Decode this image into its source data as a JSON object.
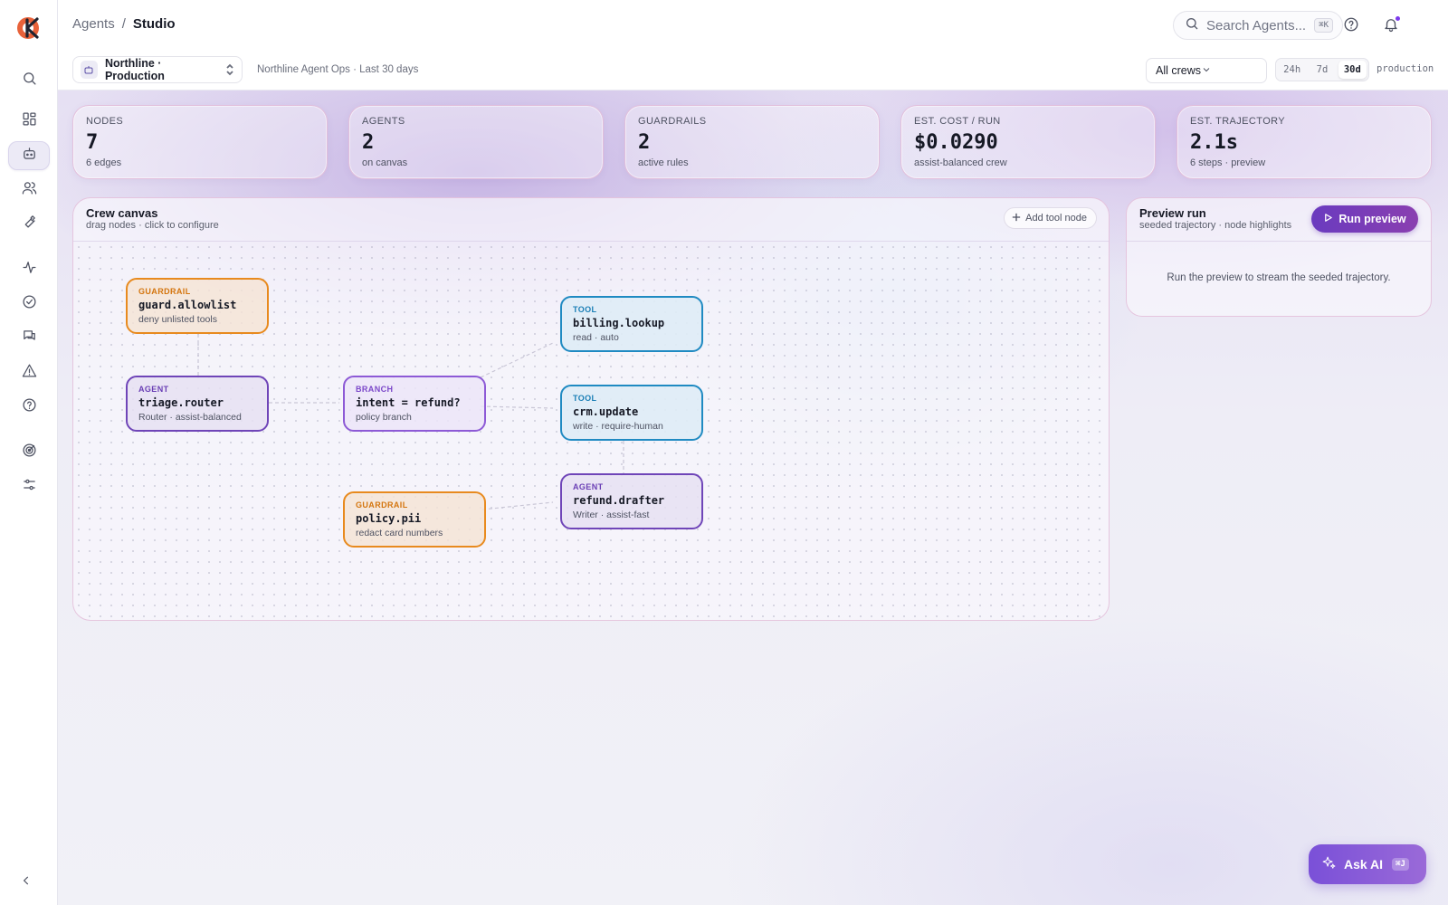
{
  "breadcrumb": {
    "parent": "Agents",
    "separator": "/",
    "current": "Studio"
  },
  "search": {
    "placeholder": "Search Agents...",
    "shortcut": "⌘K"
  },
  "workspace": {
    "name": "Northline · Production",
    "context": "Northline Agent Ops · Last 30 days"
  },
  "filters": {
    "crew": "All crews",
    "ranges": [
      "24h",
      "7d",
      "30d"
    ],
    "active_range": "30d",
    "environment": "production"
  },
  "stats": [
    {
      "label": "NODES",
      "value": "7",
      "sub": "6 edges"
    },
    {
      "label": "AGENTS",
      "value": "2",
      "sub": "on canvas"
    },
    {
      "label": "GUARDRAILS",
      "value": "2",
      "sub": "active rules"
    },
    {
      "label": "EST. COST / RUN",
      "value": "$0.0290",
      "sub": "assist-balanced crew"
    },
    {
      "label": "EST. TRAJECTORY",
      "value": "2.1s",
      "sub": "6 steps · preview"
    }
  ],
  "canvas": {
    "title": "Crew canvas",
    "subtitle": "drag nodes · click to configure",
    "add_button": "Add tool node",
    "nodes": [
      {
        "kind": "GUARDRAIL",
        "name": "guard.allowlist",
        "desc": "deny unlisted tools"
      },
      {
        "kind": "AGENT",
        "name": "triage.router",
        "desc": "Router · assist-balanced"
      },
      {
        "kind": "BRANCH",
        "name": "intent = refund?",
        "desc": "policy branch"
      },
      {
        "kind": "TOOL",
        "name": "billing.lookup",
        "desc": "read · auto"
      },
      {
        "kind": "TOOL",
        "name": "crm.update",
        "desc": "write · require-human"
      },
      {
        "kind": "AGENT",
        "name": "refund.drafter",
        "desc": "Writer · assist-fast"
      },
      {
        "kind": "GUARDRAIL",
        "name": "policy.pii",
        "desc": "redact card numbers"
      }
    ]
  },
  "preview": {
    "title": "Preview run",
    "subtitle": "seeded trajectory · node highlights",
    "run_button": "Run preview",
    "empty_text": "Run the preview to stream the seeded trajectory."
  },
  "ask_ai": {
    "label": "Ask AI",
    "shortcut": "⌘J"
  },
  "colors": {
    "accent": "#6a3bbf",
    "guardrail": "#e88a1e",
    "agent": "#6f45b8",
    "tool": "#1f8ac2",
    "logo_primary": "#e8623a"
  }
}
